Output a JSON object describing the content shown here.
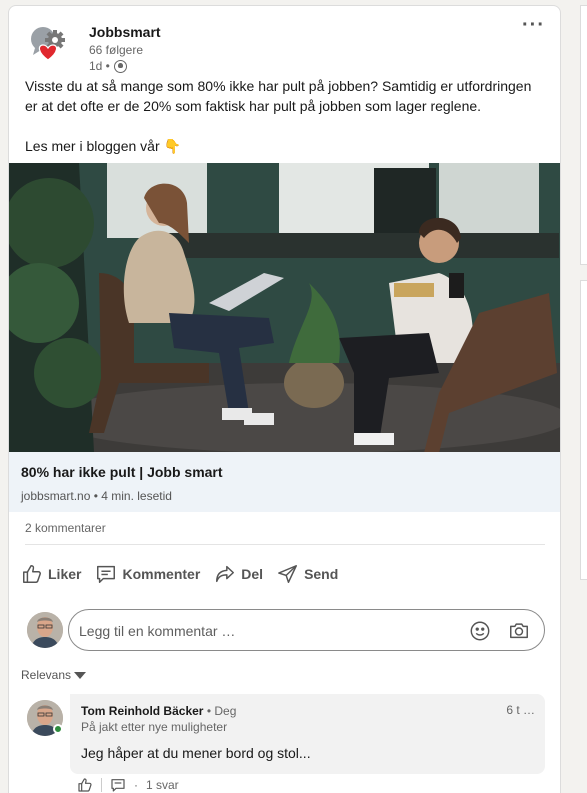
{
  "post": {
    "company": "Jobbsmart",
    "followers": "66 følgere",
    "time": "1d •",
    "text_line1": "Visste du at så mange som 80% ikke har pult på jobben? Samtidig er utfordringen er at det ofte er de 20% som faktisk har pult på jobben som lager reglene.",
    "text_line2": "Les mer i bloggen vår",
    "hand_icon": "👇"
  },
  "link": {
    "title": "80% har ikke pult | Jobb smart",
    "subtitle": "jobbsmart.no • 4 min. lesetid"
  },
  "stats": {
    "comments": "2 kommentarer"
  },
  "actions": {
    "like": "Liker",
    "comment": "Kommenter",
    "share": "Del",
    "send": "Send"
  },
  "comment_box": {
    "placeholder": "Legg til en kommentar …"
  },
  "sort": {
    "label": "Relevans"
  },
  "comments": [
    {
      "name": "Tom Reinhold Bäcker",
      "degree": "• Deg",
      "headline": "På jakt etter nye muligheter",
      "time": "6 t",
      "more": "…",
      "text": "Jeg håper at du mener bord og stol...",
      "replies": "1 svar",
      "reply_sep": "·"
    }
  ],
  "colors": {
    "link_bg": "#eef3f8",
    "online": "#2e8b3e",
    "logo_heart": "#e0282e"
  }
}
